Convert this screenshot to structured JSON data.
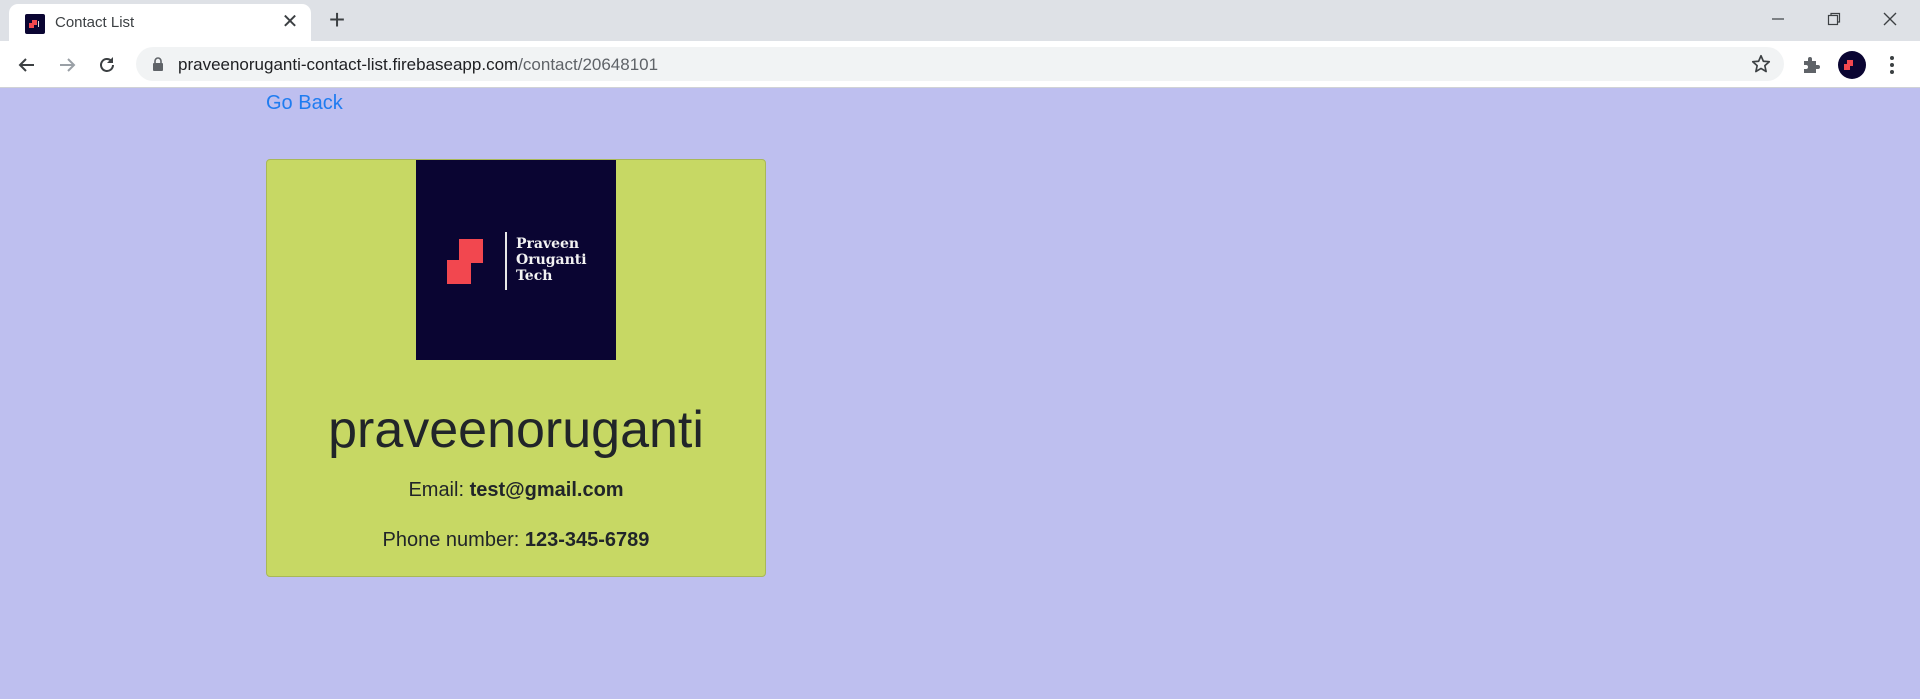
{
  "browser": {
    "tab": {
      "title": "Contact List",
      "close_glyph": "✕"
    },
    "new_tab_glyph": "+",
    "url": {
      "host": "praveenoruganti-contact-list.firebaseapp.com",
      "path": "/contact/20648101"
    },
    "icons": {
      "back": "arrow-left-icon",
      "forward": "arrow-right-icon",
      "reload": "reload-icon",
      "lock": "lock-icon",
      "star": "star-icon",
      "extensions": "puzzle-icon",
      "menu": "kebab-menu-icon"
    }
  },
  "page": {
    "go_back": "Go Back",
    "contact": {
      "logo_text": [
        "Praveen",
        "Oruganti",
        "Tech"
      ],
      "name": "praveenoruganti",
      "email_label": "Email:",
      "email": "test@gmail.com",
      "phone_label": "Phone number:",
      "phone": "123-345-6789"
    }
  },
  "colors": {
    "page_background": "#bebfef",
    "card_background": "#c7d864",
    "link": "#1f7cf0",
    "logo_background": "#0a0532",
    "logo_accent": "#f2474f"
  }
}
